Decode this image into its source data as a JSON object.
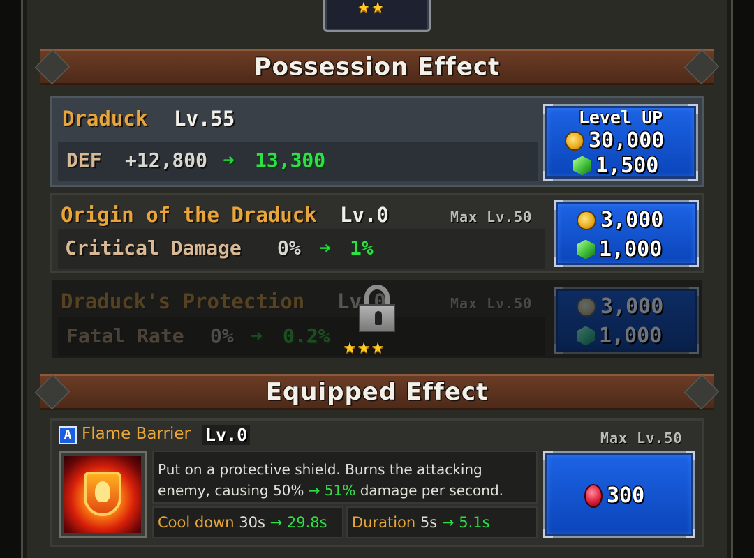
{
  "possession_header": "Possession Effect",
  "equipped_header": "Equipped Effect",
  "main_effect": {
    "name": "Draduck",
    "level": "Lv.55",
    "stat_label": "DEF",
    "stat_from": "+12,800",
    "stat_to": "13,300",
    "button_title": "Level UP",
    "gold_cost": "30,000",
    "gem_cost": "1,500"
  },
  "origin_effect": {
    "name": "Origin of the Draduck",
    "level": "Lv.0",
    "max_level": "Max Lv.50",
    "stat_label": "Critical Damage",
    "stat_from": "0%",
    "stat_to": "1%",
    "gold_cost": "3,000",
    "gem_cost": "1,000"
  },
  "protection_effect": {
    "name": "Draduck's Protection",
    "level": "Lv.0",
    "max_level": "Max Lv.50",
    "stat_label": "Fatal Rate",
    "stat_from": "0%",
    "stat_to": "0.2%",
    "gold_cost": "3,000",
    "gem_cost": "1,000",
    "locked": true,
    "unlock_stars": 3
  },
  "portrait_stars": 2,
  "skill": {
    "badge": "A",
    "name": "Flame Barrier",
    "level": "Lv.0",
    "max_level": "Max Lv.50",
    "desc_line1": "Put on a protective shield. Burns the attacking",
    "desc_line2_pre": "enemy, causing 50%",
    "desc_arrow": "→",
    "desc_to": "51%",
    "desc_line2_post": "damage per second.",
    "cooldown_label": "Cool down",
    "cooldown_from": "30s",
    "cooldown_to": "29.8s",
    "duration_label": "Duration",
    "duration_from": "5s",
    "duration_to": "5.1s",
    "ruby_cost": "300"
  },
  "colors": {
    "accent_orange": "#e8a63a",
    "increase_green": "#2ee046",
    "button_blue": "#1d64e6"
  }
}
